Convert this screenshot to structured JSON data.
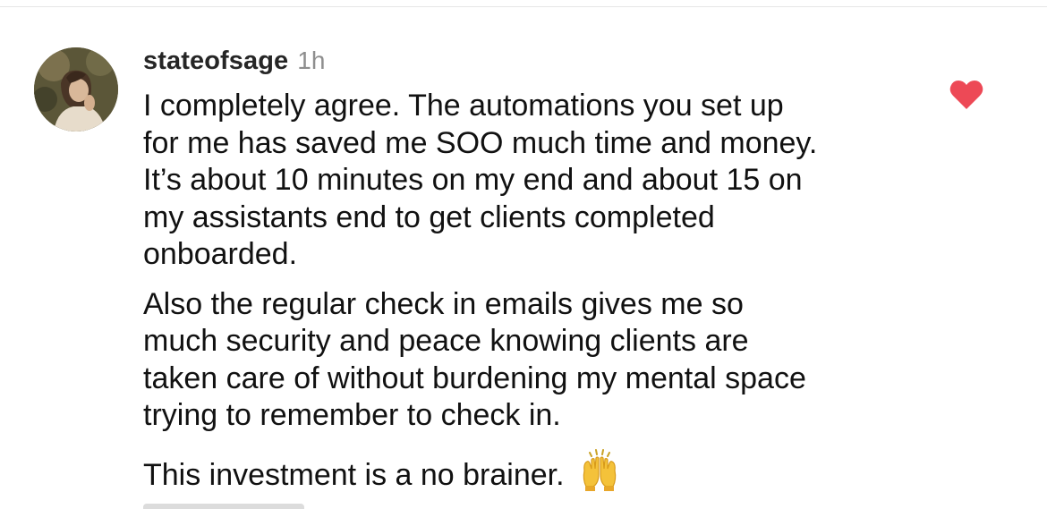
{
  "comment": {
    "username": "stateofsage",
    "timestamp": "1h",
    "liked": true,
    "like_color": "#ed4956",
    "paragraphs": [
      {
        "lines": [
          "I completely agree. The automations you set up",
          "for me has saved me SOO much time and money.",
          "It’s about 10 minutes on my end and about 15 on",
          "my assistants end to get clients completed",
          "onboarded."
        ]
      },
      {
        "lines": [
          "Also the regular check in emails gives me so",
          "much security and peace knowing clients are",
          "taken care of without burdening my mental space",
          "trying to remember to check in."
        ]
      },
      {
        "lines": [
          "This investment is a no brainer."
        ],
        "emoji": "raising-hands-icon"
      }
    ]
  },
  "colors": {
    "username": "#262626",
    "timestamp": "#8e8e8e",
    "text": "#111111"
  }
}
